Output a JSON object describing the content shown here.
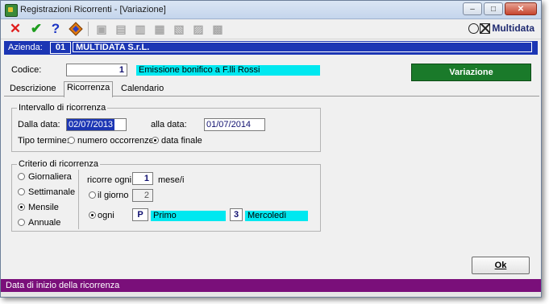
{
  "window": {
    "title": "Registrazioni Ricorrenti - [Variazione]",
    "minimize_glyph": "–",
    "maximize_glyph": "□",
    "close_glyph": "✕"
  },
  "toolbar": {
    "cancel_icon": "✕",
    "confirm_icon": "✔",
    "help_icon": "?",
    "disabled_icons": [
      "▣",
      "▤",
      "▥",
      "▦",
      "▧",
      "▨",
      "▩"
    ],
    "logo_text": "Multidata"
  },
  "azienda": {
    "label": "Azienda:",
    "code": "01",
    "name": "MULTIDATA S.r.L."
  },
  "codice": {
    "label": "Codice:",
    "value": "1",
    "description": "Emissione bonifico a F.lli Rossi"
  },
  "mode_button": {
    "label": "Variazione",
    "color": "#1a7a2a"
  },
  "tabs": [
    {
      "label": "Descrizione",
      "underline_char": "D"
    },
    {
      "label": "Ricorrenza",
      "underline_char": "R",
      "active": true
    },
    {
      "label": "Calendario",
      "underline_char": "C"
    }
  ],
  "intervallo": {
    "title": "Intervallo di ricorrenza",
    "dalla_data_label": "Dalla data:",
    "dalla_data_value": "02/07/2013",
    "alla_data_label": "alla data:",
    "alla_data_value": "01/07/2014",
    "tipo_termine_label": "Tipo termine:",
    "opt_occorrenze": "numero occorrenze",
    "opt_data_finale": "data finale",
    "selected": "data finale"
  },
  "criterio": {
    "title": "Criterio di ricorrenza",
    "frequencies": [
      "Giornaliera",
      "Settimanale",
      "Mensile",
      "Annuale"
    ],
    "selected_frequency": "Mensile",
    "ricorre_ogni_label": "ricorre ogni",
    "ricorre_ogni_value": "1",
    "mesi_label": "mese/i",
    "il_giorno_label": "il giorno",
    "il_giorno_value": "2",
    "ogni_label": "ogni",
    "ogni_code": "P",
    "ogni_desc": "Primo",
    "ogni_day_code": "3",
    "ogni_day_desc": "Mercoledì",
    "selected_option": "ogni"
  },
  "ok_button": {
    "label": "Ok"
  },
  "statusbar": {
    "text": "Data di inizio della ricorrenza",
    "color": "#7a0f7a"
  },
  "colors": {
    "azienda_bar": "#1c36b4",
    "highlight_cyan": "#00e8f0"
  }
}
